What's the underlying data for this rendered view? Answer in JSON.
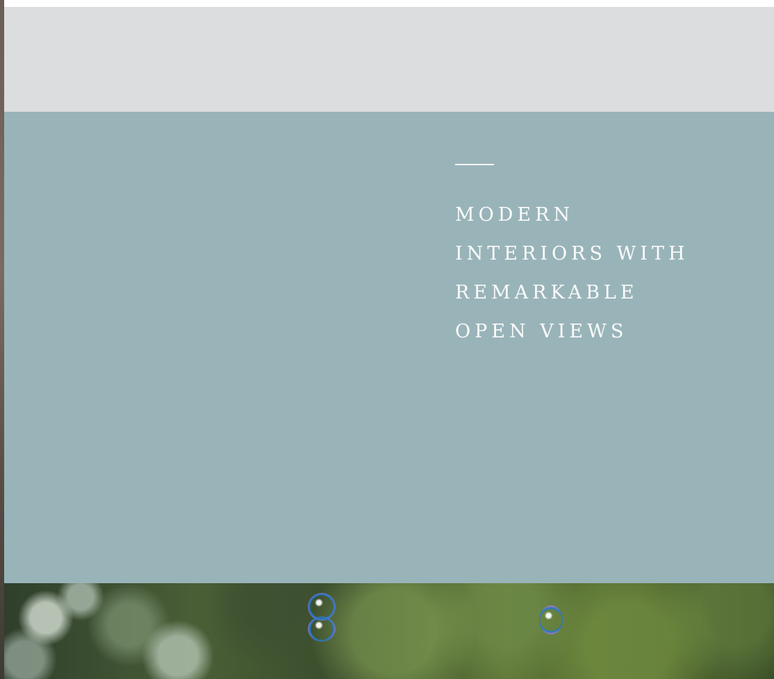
{
  "hero": {
    "headline_lines": [
      "MODERN",
      "INTERIORS WITH",
      "REMARKABLE",
      "OPEN VIEWS"
    ]
  },
  "colors": {
    "gray_band": "#dcdddf",
    "teal_panel": "#99b4b9",
    "headline_text": "#fbfbfb"
  },
  "icons": {
    "accent": "horizontal-accent-line"
  }
}
